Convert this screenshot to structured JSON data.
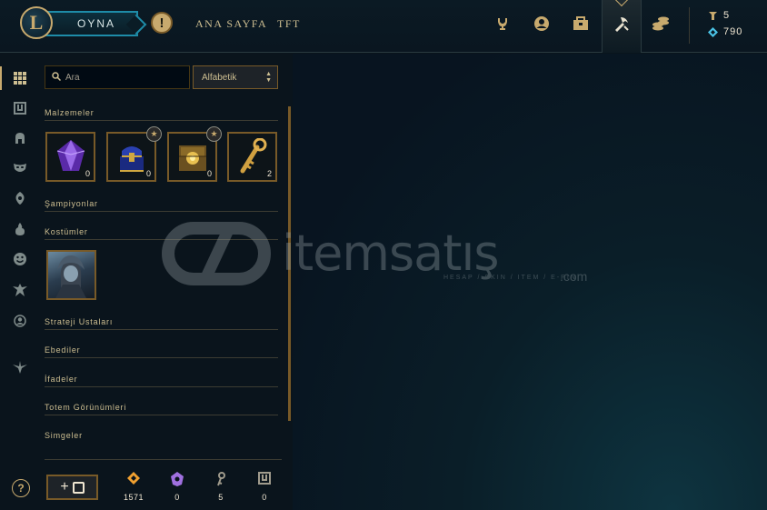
{
  "topbar": {
    "logo_letter": "L",
    "play_label": "OYNA",
    "alert_symbol": "!",
    "nav_links": [
      "ANA SAYFA",
      "TFT"
    ],
    "nav_icons": [
      "trophy-icon",
      "profile-icon",
      "collection-icon",
      "loot-icon",
      "store-icon"
    ],
    "active_nav": "loot-icon",
    "currencies": [
      {
        "icon": "rp-icon",
        "value": "5",
        "color": "#c8aa6e"
      },
      {
        "icon": "blue-essence-icon",
        "value": "790",
        "color": "#4ac3e6"
      }
    ]
  },
  "sidebar": {
    "icons": [
      "all-items-icon",
      "chest-icon",
      "champion-icon",
      "skin-icon",
      "ward-icon",
      "emote-fire-icon",
      "emote-icon",
      "tft-icon",
      "profile-icon",
      "eternals-icon"
    ],
    "active": "all-items-icon",
    "help_symbol": "?"
  },
  "inventory": {
    "search_placeholder": "Ara",
    "sort_value": "Alfabetik",
    "sections": [
      "Malzemeler",
      "Şampiyonlar",
      "Kostümler",
      "Strateji Ustaları",
      "Ebediler",
      "İfadeler",
      "Totem Görünümleri",
      "Simgeler"
    ],
    "materials": [
      {
        "name": "mythic-essence-crystal",
        "count": "0",
        "starred": false
      },
      {
        "name": "masterwork-chest",
        "count": "0",
        "starred": true
      },
      {
        "name": "hextech-chest",
        "count": "0",
        "starred": true
      },
      {
        "name": "hextech-key",
        "count": "2",
        "starred": false
      }
    ]
  },
  "footer_stats": [
    {
      "icon": "orange-essence-icon",
      "value": "1571",
      "color": "#f0a030"
    },
    {
      "icon": "mythic-essence-icon",
      "value": "0",
      "color": "#a070e0"
    },
    {
      "icon": "key-fragment-icon",
      "value": "5",
      "color": "#a09b8c"
    },
    {
      "icon": "chest-count-icon",
      "value": "0",
      "color": "#a09b8c"
    }
  ],
  "watermark": {
    "brand": "itemsatış",
    "tagline": "HESAP / SKIN / ITEM / E-PIN",
    "suffix": ".com"
  },
  "colors": {
    "gold": "#c8aa6e",
    "border_gold": "#785a28",
    "background": "#0a141c"
  }
}
